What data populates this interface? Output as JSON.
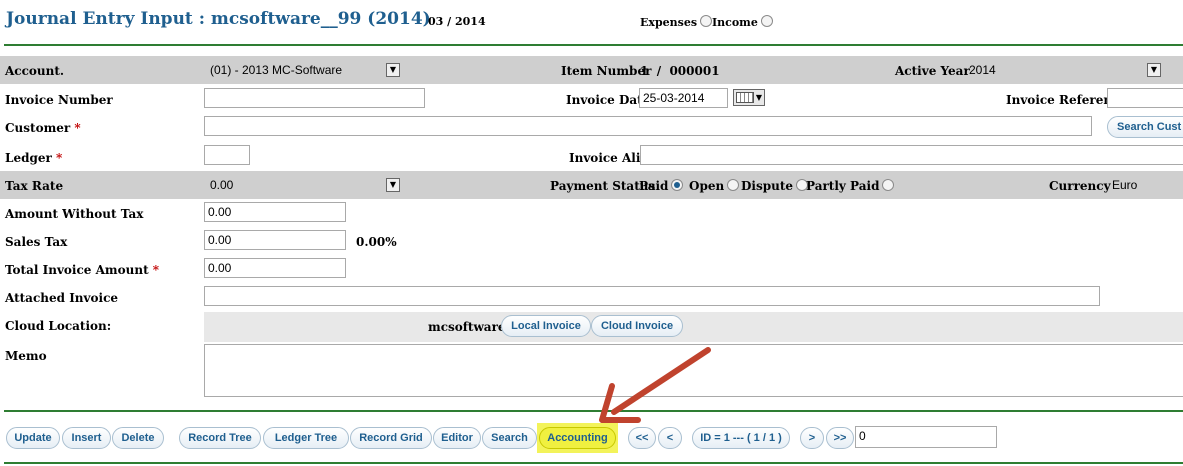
{
  "header": {
    "title": "Journal Entry Input : mcsoftware__99 (2014)",
    "period": "03 / 2014",
    "expenses_label": "Expenses",
    "income_label": "Income"
  },
  "account_row": {
    "label": "Account.",
    "value": "(01) - 2013 MC-Software",
    "item_number_label": "Item Number",
    "item_number_value": "1  /  000001",
    "active_year_label": "Active Year",
    "active_year_value": "2014"
  },
  "invoice": {
    "number_label": "Invoice Number",
    "number_value": "",
    "date_label": "Invoice Date",
    "date_value": "25-03-2014",
    "reference_label": "Invoice Reference",
    "reference_value": ""
  },
  "customer": {
    "label": "Customer",
    "value": "",
    "search_button": "Search Cust"
  },
  "ledger": {
    "label": "Ledger",
    "value": "",
    "alias_label": "Invoice Alias",
    "alias_value": ""
  },
  "tax_row": {
    "label": "Tax Rate",
    "value": "0.00",
    "payment_status_label": "Payment Status",
    "statuses": [
      "Paid",
      "Open",
      "Dispute",
      "Partly Paid"
    ],
    "selected_status": "Paid",
    "currency_label": "Currency",
    "currency_value": "Euro"
  },
  "amounts": {
    "without_tax_label": "Amount Without Tax",
    "without_tax_value": "0.00",
    "sales_tax_label": "Sales Tax",
    "sales_tax_value": "0.00",
    "sales_tax_pct": "0.00%",
    "total_label": "Total Invoice Amount",
    "total_value": "0.00"
  },
  "attached": {
    "label": "Attached Invoice",
    "value": ""
  },
  "cloud": {
    "label": "Cloud Location:",
    "owner": "mcsoftware",
    "local_button": "Local Invoice",
    "cloud_button": "Cloud Invoice"
  },
  "memo": {
    "label": "Memo",
    "value": ""
  },
  "toolbar": {
    "update": "Update",
    "insert": "Insert",
    "delete": "Delete",
    "record_tree": "Record Tree",
    "ledger_tree": "Ledger Tree",
    "record_grid": "Record Grid",
    "editor": "Editor",
    "search": "Search",
    "accounting": "Accounting",
    "first": "<<",
    "prev": "<",
    "id_label": "ID = 1 --- ( 1 / 1 )",
    "next": ">",
    "last": ">>",
    "goto_value": "0"
  },
  "colors": {
    "title": "#1f5f8f",
    "band": "#cfcfcf",
    "rule": "#2e7d32",
    "highlight": "#f3f35a",
    "arrow": "#c0432e"
  }
}
